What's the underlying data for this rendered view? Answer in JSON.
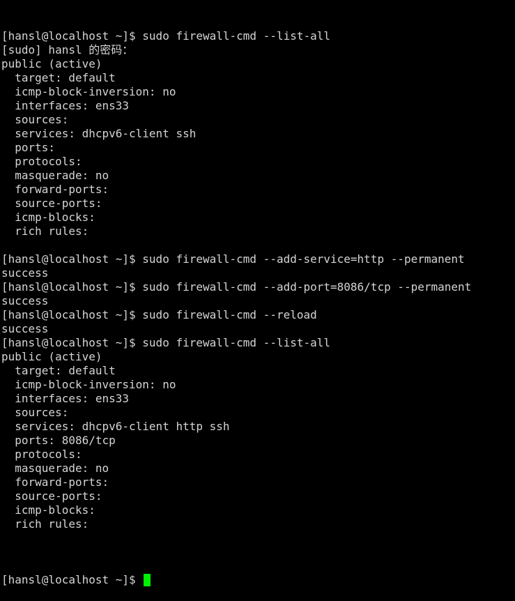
{
  "terminal": {
    "colors": {
      "background": "#000000",
      "foreground": "#d5d5d5",
      "cursor": "#00ee00"
    },
    "prompt": "[hansl@localhost ~]$ ",
    "cursor_glyph": "block-cursor",
    "lines": [
      "[hansl@localhost ~]$ sudo firewall-cmd --list-all",
      "[sudo] hansl 的密码：",
      "public (active)",
      "  target: default",
      "  icmp-block-inversion: no",
      "  interfaces: ens33",
      "  sources:",
      "  services: dhcpv6-client ssh",
      "  ports:",
      "  protocols:",
      "  masquerade: no",
      "  forward-ports:",
      "  source-ports:",
      "  icmp-blocks:",
      "  rich rules:",
      "",
      "[hansl@localhost ~]$ sudo firewall-cmd --add-service=http --permanent",
      "success",
      "[hansl@localhost ~]$ sudo firewall-cmd --add-port=8086/tcp --permanent",
      "success",
      "[hansl@localhost ~]$ sudo firewall-cmd --reload",
      "success",
      "[hansl@localhost ~]$ sudo firewall-cmd --list-all",
      "public (active)",
      "  target: default",
      "  icmp-block-inversion: no",
      "  interfaces: ens33",
      "  sources:",
      "  services: dhcpv6-client http ssh",
      "  ports: 8086/tcp",
      "  protocols:",
      "  masquerade: no",
      "  forward-ports:",
      "  source-ports:",
      "  icmp-blocks:",
      "  rich rules:",
      ""
    ],
    "final_prompt": "[hansl@localhost ~]$ "
  }
}
